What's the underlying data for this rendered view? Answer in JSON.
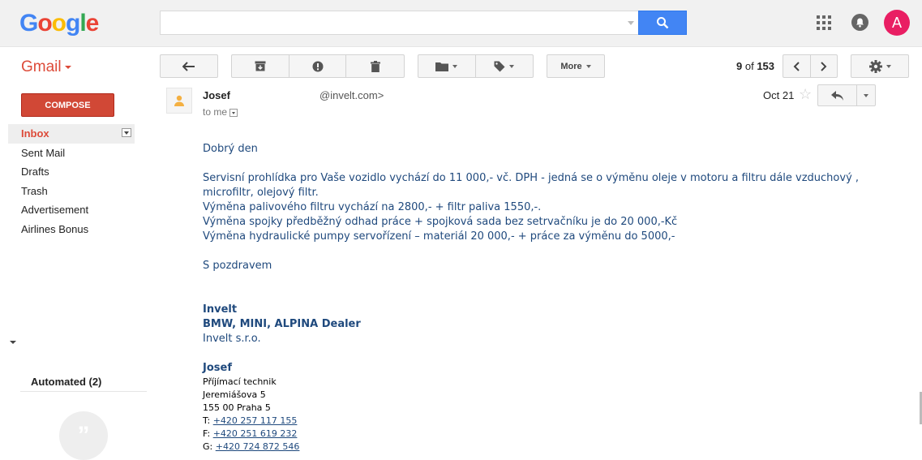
{
  "brand": {
    "logo_letters": [
      "G",
      "o",
      "o",
      "g",
      "l",
      "e"
    ],
    "logo_colors": [
      "#4285f4",
      "#ea4335",
      "#fbbc05",
      "#4285f4",
      "#34a853",
      "#ea4335"
    ],
    "product": "Gmail",
    "accent": "#dd4b39"
  },
  "search": {
    "value": "",
    "placeholder": ""
  },
  "account": {
    "initial": "A",
    "color": "#e91e63"
  },
  "toolbar": {
    "more_label": "More",
    "pager_range": "9",
    "pager_of": "of",
    "pager_total": "153"
  },
  "compose_label": "COMPOSE",
  "nav": {
    "items": [
      "Inbox",
      "Sent Mail",
      "Drafts",
      "Trash",
      "Advertisement",
      "Airlines Bonus"
    ]
  },
  "automated_label": "Automated (2)",
  "email": {
    "sender_name": "Josef",
    "sender_email": "@invelt.com>",
    "to_me": "to me",
    "date": "Oct 21",
    "greeting": "Dobrý den",
    "lines": [
      "Servisní prohlídka pro Vaše vozidlo vychází do 11 000,- vč. DPH  - jedná se o výměnu oleje v motoru a filtru dále vzduchový , microfiltr, olejový filtr.",
      "Výměna palivového filtru vychází na 2800,- + filtr paliva 1550,-.",
      "Výměna spojky předběžný odhad práce + spojková sada bez setrvačníku je do 20 000,-Kč",
      "Výměna hydraulické pumpy servořízení  – materiál 20 000,- + práce za výměnu do 5000,-"
    ],
    "closing": "S pozdravem",
    "company": "Invelt",
    "dealer": "BMW, MINI, ALPINA Dealer",
    "company_full": "Invelt s.r.o.",
    "sig_name": "Josef",
    "sig_role": "Příjímací technik",
    "sig_street": "Jeremiášova 5",
    "sig_city": "155 00 Praha 5",
    "phone_label": "T:",
    "phone": "+420 257 117 155",
    "fax_label": "F:",
    "fax": "+420 251 619 232",
    "mobile_label": "G:",
    "mobile": "+420 724 872 546"
  }
}
